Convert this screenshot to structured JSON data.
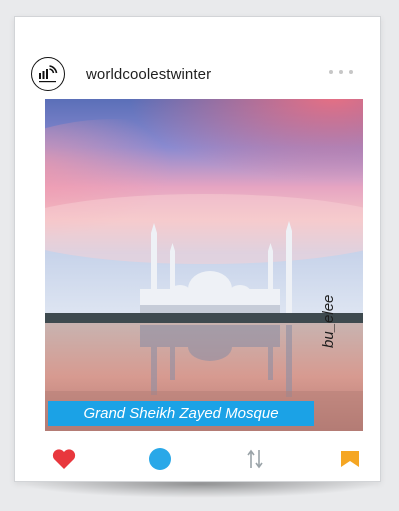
{
  "post": {
    "username": "worldcoolestwinter",
    "caption": "Grand Sheikh Zayed Mosque",
    "photo_credit": "bu_elee"
  },
  "icons": {
    "logo": "wifi-signal-logo-icon",
    "more": "more-dots-icon",
    "like": "heart-icon",
    "comment": "comment-circle-icon",
    "sort": "sort-arrows-icon",
    "bookmark": "bookmark-icon"
  },
  "colors": {
    "like": "#e8373d",
    "comment": "#29a8e8",
    "bookmark": "#f5a623",
    "caption_bg": "#1ba2e6",
    "sort": "#9aa3a8"
  }
}
